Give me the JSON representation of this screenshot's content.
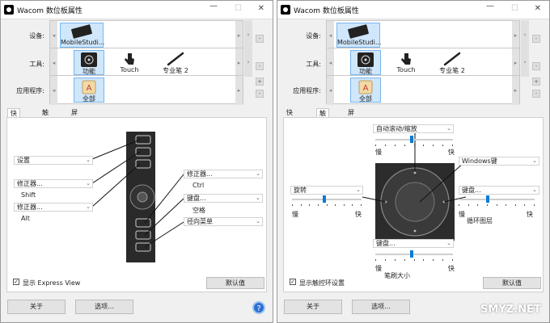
{
  "window1": {
    "title": "Wacom 数位板属性",
    "device_label": "设备:",
    "tool_label": "工具:",
    "app_label": "应用程序:",
    "device_tile": "MobileStudi...",
    "tools": [
      "功能",
      "Touch",
      "专业笔 2"
    ],
    "app_tile": "全部",
    "tabs": [
      "快捷键",
      "触控环",
      "屏幕控制"
    ],
    "left_dropdowns": [
      {
        "value": "设置",
        "sub": ""
      },
      {
        "value": "修正器...",
        "sub": "Shift"
      },
      {
        "value": "修正器...",
        "sub": "Alt"
      }
    ],
    "right_dropdowns": [
      {
        "value": "修正器...",
        "sub": "Ctrl"
      },
      {
        "value": "键盘...",
        "sub": "空格"
      },
      {
        "value": "径向菜单",
        "sub": ""
      }
    ],
    "checkbox_label": "显示 Express View",
    "default_button": "默认值",
    "about_button": "关于",
    "options_button": "选项...",
    "help_glyph": "?"
  },
  "window2": {
    "title": "Wacom 数位板属性",
    "device_label": "设备:",
    "tool_label": "工具:",
    "app_label": "应用程序:",
    "device_tile": "MobileStudi...",
    "tools": [
      "功能",
      "Touch",
      "专业笔 2"
    ],
    "app_tile": "全部",
    "tabs": [
      "快捷键",
      "触控环",
      "屏幕控制"
    ],
    "top_dropdown": "自动滚动/缩放",
    "top_slow": "慢",
    "top_fast": "快",
    "center_dropdown": "Windows键",
    "left_dropdown": "旋转",
    "left_slow": "慢",
    "left_fast": "快",
    "right_dropdown": "键盘...",
    "right_slow": "慢",
    "right_fast": "快",
    "right_sub": "循环图层",
    "bottom_dropdown": "键盘...",
    "bottom_slow": "慢",
    "bottom_fast": "快",
    "bottom_sub": "笔刷大小",
    "checkbox_label": "显示触控环设置",
    "default_button": "默认值",
    "about_button": "关于",
    "options_button": "选项..."
  },
  "watermark": "SMYZ.NET",
  "colors": {
    "accent": "#0a7ad6",
    "selected_tile": "#cfe6fb",
    "help": "#2d6fd4"
  }
}
